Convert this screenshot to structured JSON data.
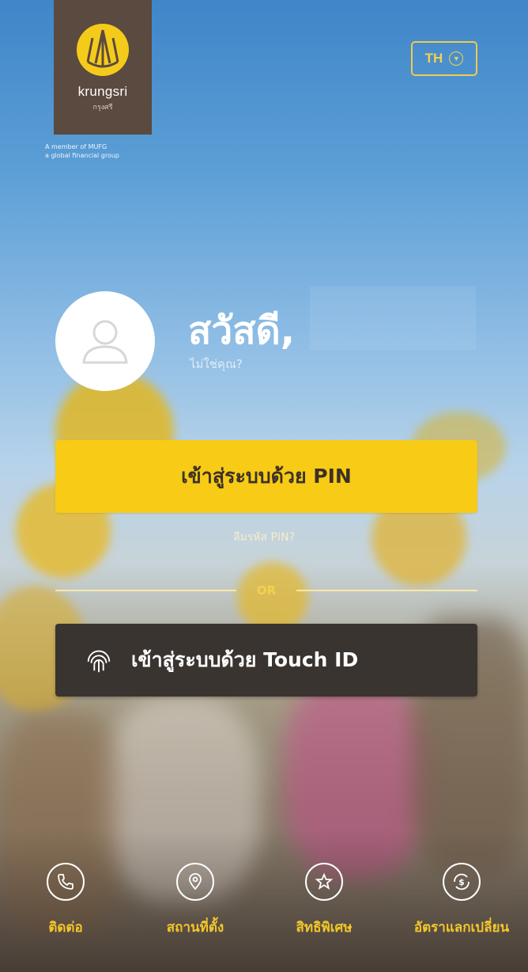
{
  "logo": {
    "name": "krungsri",
    "sub": "กรุงศรี",
    "member_line1": "A member of MUFG",
    "member_line2": "a global financial group"
  },
  "language": {
    "selected": "TH"
  },
  "greeting": {
    "text": "สวัสดี,",
    "not_you": "ไม่ใช่คุณ?"
  },
  "pin_button": {
    "label": "เข้าสู่ระบบด้วย PIN"
  },
  "forgot_pin": {
    "label": "ลืมรหัส PIN?"
  },
  "divider": {
    "label": "OR"
  },
  "touch_button": {
    "label": "เข้าสู่ระบบด้วย Touch ID"
  },
  "nav": {
    "items": [
      {
        "label": "ติดต่อ",
        "icon": "phone-icon"
      },
      {
        "label": "สถานที่ตั้ง",
        "icon": "location-pin-icon"
      },
      {
        "label": "สิทธิพิเศษ",
        "icon": "star-icon"
      },
      {
        "label": "อัตราแลกเปลี่ยน",
        "icon": "currency-exchange-icon"
      }
    ]
  },
  "colors": {
    "accent": "#f7cb16",
    "dark_button": "#3a3431",
    "logo_bg": "#5b4a3f"
  }
}
